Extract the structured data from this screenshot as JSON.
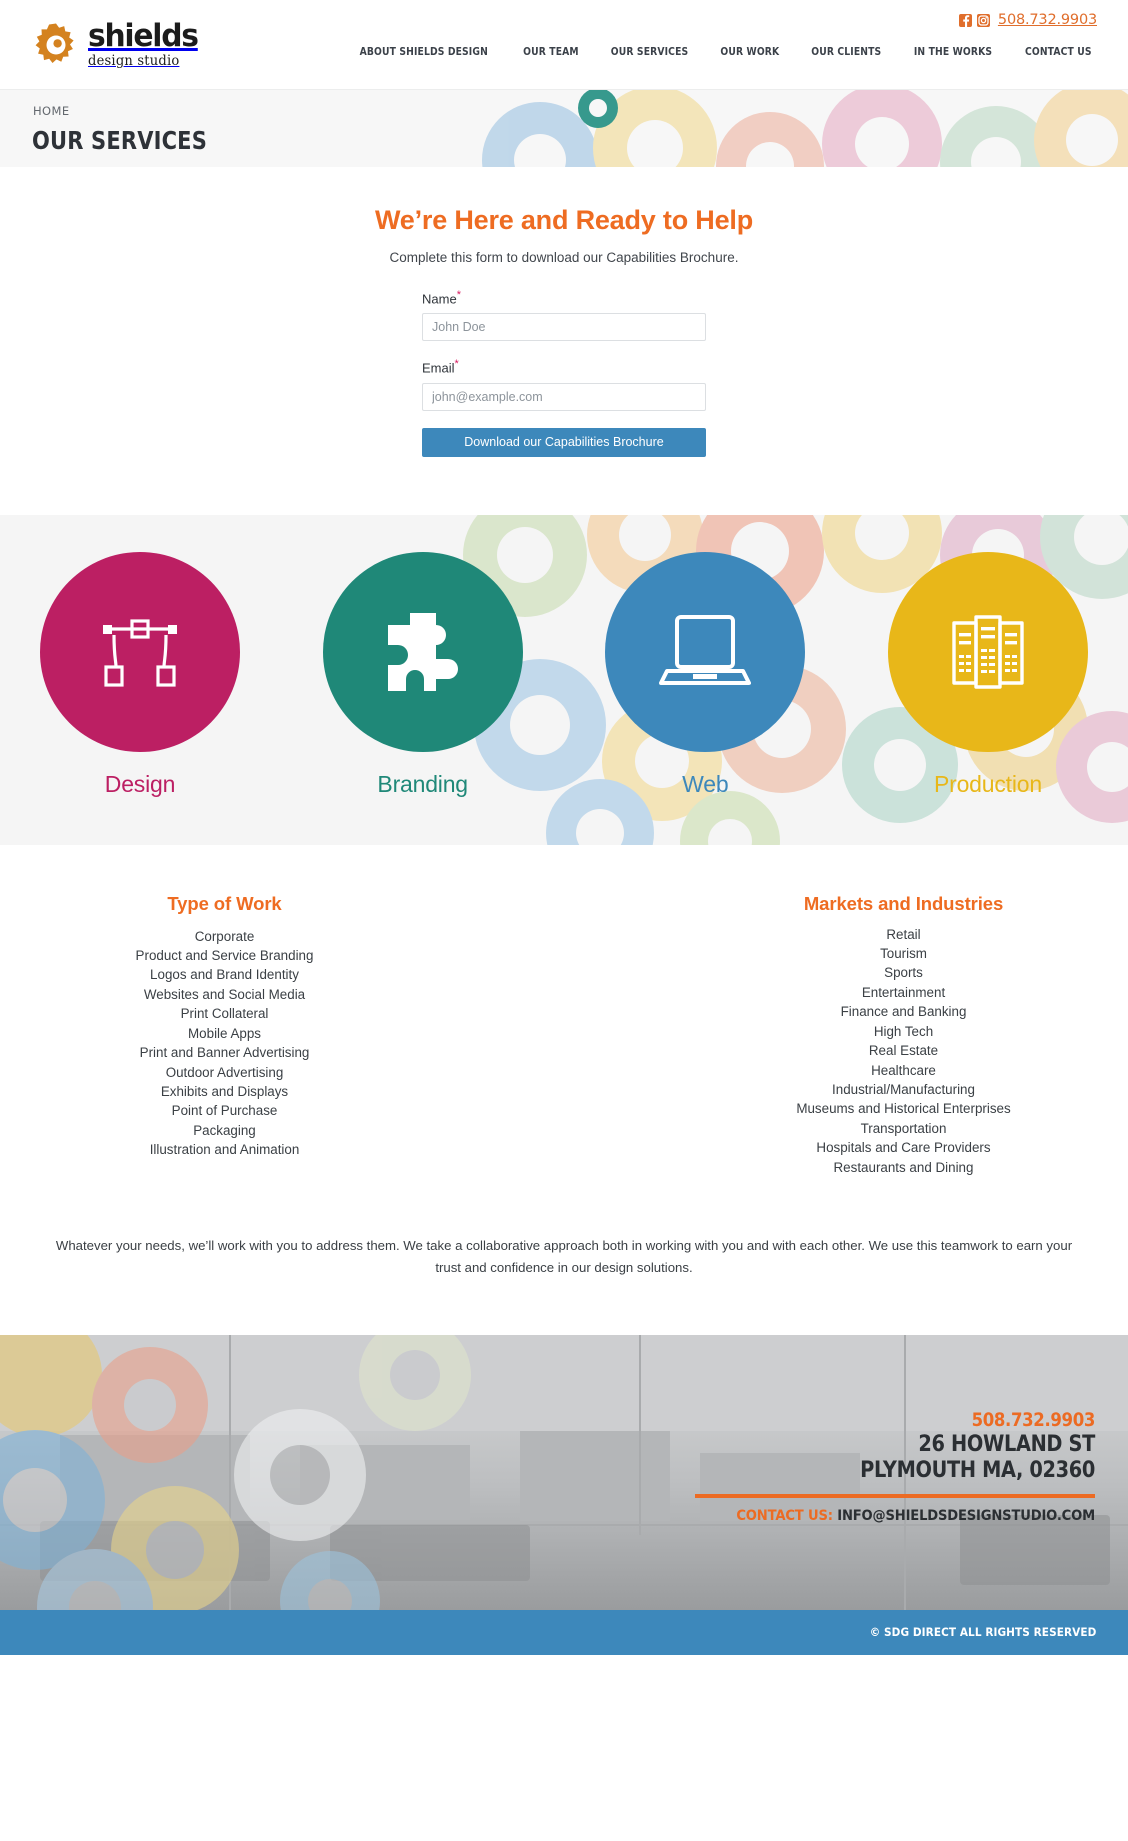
{
  "header": {
    "logo_main": "shields",
    "logo_sub": "design studio",
    "phone": "508.732.9903",
    "facebook_icon": "facebook-icon",
    "instagram_icon": "instagram-icon",
    "nav": [
      "ABOUT SHIELDS DESIGN",
      "OUR TEAM",
      "OUR SERVICES",
      "OUR WORK",
      "OUR CLIENTS",
      "IN THE WORKS",
      "CONTACT US"
    ]
  },
  "titleband": {
    "breadcrumb": "HOME",
    "title": "OUR SERVICES"
  },
  "form": {
    "heading": "We’re Here and Ready to Help",
    "subheading": "Complete this form to download our Capabilities Brochure.",
    "name_label": "Name",
    "name_required": "*",
    "name_value": "",
    "name_placeholder": "John Doe",
    "email_label": "Email",
    "email_required": "*",
    "email_value": "",
    "email_placeholder": "john@example.com",
    "submit_label": "Download our Capabilities Brochure",
    "submit_color": "#3d88bb",
    "heading_color": "#ee6c22"
  },
  "services": [
    {
      "label": "Design",
      "color": "#bc1f63",
      "icon": "pen-tool-icon"
    },
    {
      "label": "Branding",
      "color": "#1f8878",
      "icon": "puzzle-piece-icon"
    },
    {
      "label": "Web",
      "color": "#3d88bb",
      "icon": "laptop-icon"
    },
    {
      "label": "Production",
      "color": "#e8b719",
      "icon": "brochure-icon"
    }
  ],
  "type_of_work": {
    "heading": "Type of Work",
    "items": [
      "Corporate",
      "Product and Service Branding",
      "Logos and Brand Identity",
      "Websites and Social Media",
      "Print Collateral",
      "Mobile Apps",
      "Print and Banner Advertising",
      "Outdoor Advertising",
      "Exhibits and Displays",
      "Point of Purchase",
      "Packaging",
      "Illustration and Animation"
    ]
  },
  "markets": {
    "heading": "Markets and Industries",
    "items": [
      "Retail",
      "Tourism",
      "Sports",
      "Entertainment",
      "Finance and Banking",
      "High Tech",
      "Real Estate",
      "Healthcare",
      "Industrial/Manufacturing",
      "Museums and Historical Enterprises",
      "Transportation",
      "Hospitals and Care Providers",
      "Restaurants and Dining"
    ]
  },
  "closing": {
    "paragraph": "Whatever your needs, we’ll work with you to address them. We take a collaborative approach both in working with you and with each other. We use this teamwork to earn your trust and confidence in our design solutions."
  },
  "footer": {
    "phone": "508.732.9903",
    "address_line1": "26 HOWLAND ST",
    "address_line2": "PLYMOUTH MA, 02360",
    "contact_label": "CONTACT US:",
    "contact_email": "INFO@SHIELDSDESIGNSTUDIO.COM",
    "copyright": "© SDG DIRECT ALL RIGHTS RESERVED",
    "accent_color": "#ec6b23",
    "bar_color": "#3d88bb"
  }
}
